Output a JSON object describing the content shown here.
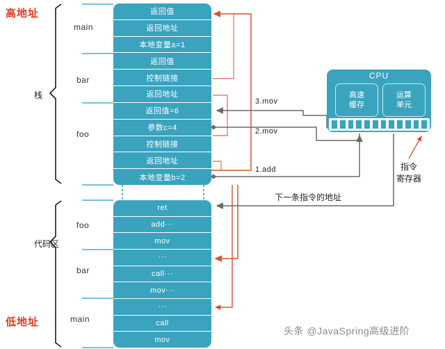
{
  "labels": {
    "high_address": "高地址",
    "low_address": "低地址",
    "stack_section": "栈",
    "code_section": "代码区",
    "next_instruction": "下一条指令的地址",
    "instruction_register": "指令\n寄存器",
    "instruction_register_line1": "指令",
    "instruction_register_line2": "寄存器"
  },
  "stack": {
    "groups": [
      {
        "name": "main",
        "rows": 3
      },
      {
        "name": "bar",
        "rows": 3
      },
      {
        "name": "foo",
        "rows": 5
      }
    ],
    "rows": [
      "返回值",
      "返回地址",
      "本地变量a=1",
      "返回值",
      "控制链接",
      "返回地址",
      "返回值=6",
      "参数c=4",
      "控制链接",
      "返回地址",
      "本地变量b=2"
    ]
  },
  "code": {
    "groups": [
      {
        "name": "foo",
        "rows": 3
      },
      {
        "name": "bar",
        "rows": 3
      },
      {
        "name": "main",
        "rows": 3
      }
    ],
    "rows": [
      "ret",
      "add···",
      "mov",
      "···",
      "call···",
      "mov···",
      "···",
      "call",
      "mov"
    ]
  },
  "cpu": {
    "title": "CPU",
    "cache_line1": "高速",
    "cache_line2": "缓存",
    "alu_line1": "运算",
    "alu_line2": "单元",
    "register_slot_count": 12
  },
  "steps": [
    {
      "id": "step1",
      "label": "1.add"
    },
    {
      "id": "step2",
      "label": "2.mov"
    },
    {
      "id": "step3",
      "label": "3.mov"
    }
  ],
  "colors": {
    "block_teal": "#3aa3bd",
    "arrow_red": "#d9512f",
    "arrow_gray": "#6a6a6a",
    "address_red": "#e03a20",
    "watermark_gray": "#8a8a8a"
  },
  "watermark": "头条 @JavaSpring高级进阶"
}
